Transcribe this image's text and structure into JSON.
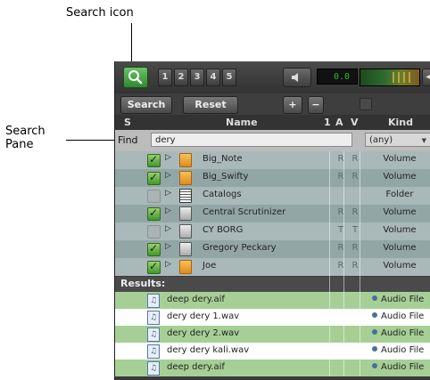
{
  "callouts": {
    "search_icon": "Search icon",
    "search_pane_line1": "Search",
    "search_pane_line2": "Pane"
  },
  "toolbar": {
    "search_icon": "search-icon",
    "memory_buttons": [
      "1",
      "2",
      "3",
      "4",
      "5"
    ],
    "speaker_icon": "speaker-icon",
    "counter_value": "0.0",
    "search_label": "Search",
    "reset_label": "Reset",
    "add_label": "+",
    "remove_label": "−"
  },
  "columns": {
    "s": "S",
    "name": "Name",
    "one": "1",
    "a": "A",
    "v": "V",
    "kind": "Kind"
  },
  "find": {
    "label": "Find",
    "value": "dery",
    "kind_selected": "(any)"
  },
  "rows": [
    {
      "name": "Big_Note",
      "checked": true,
      "icon": "volume",
      "a": "R",
      "v": "R",
      "kind": "Volume"
    },
    {
      "name": "Big_Swifty",
      "checked": true,
      "icon": "volume",
      "a": "R",
      "v": "R",
      "kind": "Volume"
    },
    {
      "name": "Catalogs",
      "checked": false,
      "icon": "folder",
      "a": "",
      "v": "",
      "kind": "Folder"
    },
    {
      "name": "Central Scrutinizer",
      "checked": true,
      "icon": "drive",
      "a": "R",
      "v": "R",
      "kind": "Volume"
    },
    {
      "name": "CY BORG",
      "checked": false,
      "icon": "drive",
      "a": "T",
      "v": "T",
      "kind": "Volume"
    },
    {
      "name": "Gregory Peckary",
      "checked": true,
      "icon": "drive",
      "a": "R",
      "v": "R",
      "kind": "Volume"
    },
    {
      "name": "Joe",
      "checked": true,
      "icon": "volume",
      "a": "R",
      "v": "R",
      "kind": "Volume"
    }
  ],
  "results": {
    "label": "Results:",
    "items": [
      {
        "name": "deep dery.aif",
        "kind": "Audio File"
      },
      {
        "name": "dery dery 1.wav",
        "kind": "Audio File"
      },
      {
        "name": "dery dery 2.wav",
        "kind": "Audio File"
      },
      {
        "name": "dery dery kali.wav",
        "kind": "Audio File"
      },
      {
        "name": "deep dery.aif",
        "kind": "Audio File"
      }
    ]
  },
  "colors": {
    "row_light": "#a9b8b8",
    "row_alt": "#93a6a6",
    "result_green": "#a6cf96",
    "result_white": "#ffffff",
    "accent_green": "#3f9a2a"
  }
}
